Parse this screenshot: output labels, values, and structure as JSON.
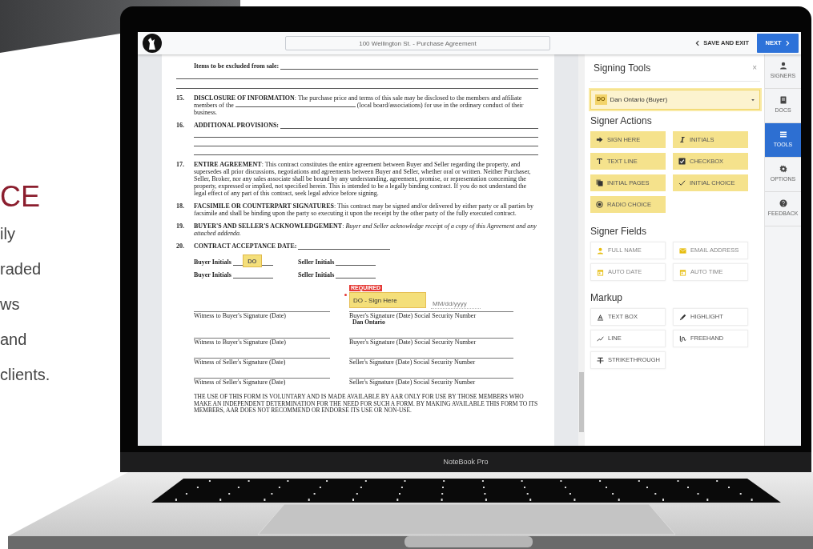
{
  "promo": {
    "heading": "CE",
    "lines": [
      "ily",
      "raded",
      "ws",
      "and",
      "clients."
    ]
  },
  "topbar": {
    "document_title": "100 Wellington St. - Purchase Agreement",
    "save_exit": "SAVE AND EXIT",
    "next": "NEXT"
  },
  "document": {
    "items": [
      {
        "kind": "fill",
        "text": "**Items to be excluded from sale:**"
      },
      {
        "kind": "clause",
        "number": "15.",
        "text": "**DISCLOSURE OF INFORMATION**: The purchase price and terms of this sale may be disclosed to the members and affiliate members of the",
        "text_after": "(local board/associations) for use in the ordinary conduct of their business."
      },
      {
        "kind": "provisions",
        "number": "16.",
        "text": "**ADDITIONAL PROVISIONS:**"
      },
      {
        "kind": "clause",
        "number": "17.",
        "text": "**ENTIRE AGREEMENT**: This contract constitutes the entire agreement between Buyer and Seller regarding the property, and supersedes all prior discussions, negotiations and agreements between Buyer and Seller, whether oral or written. Neither Purchaser, Seller, Broker, nor any sales associate shall be bound by any understanding, agreement, promise, or representation concerning the property, expressed or implied, not specified herein. This is intended to be a legally binding contract. If you do not understand the legal effect of any part of this contract, seek legal advice before signing."
      },
      {
        "kind": "clause",
        "number": "18.",
        "text": "**FACSIMILE OR COUNTERPART SIGNATURES**: This contract may be signed and/or delivered by either party or all parties by facsimile and shall be binding upon the party so executing it upon the receipt by the other party of the fully executed contract."
      },
      {
        "kind": "clause",
        "number": "19.",
        "text": "**BUYER'S AND SELLER'S ACKNOWLEDGEMENT**: *Buyer and Seller acknowledge receipt of a copy of this Agreement and any attached addenda.*"
      },
      {
        "kind": "date",
        "number": "20.",
        "text": "**CONTRACT ACCEPTANCE DATE:**"
      }
    ],
    "initials": [
      {
        "buyer": "Buyer Initials",
        "seller": "Seller Initials"
      },
      {
        "buyer": "Buyer Initials",
        "seller": "Seller Initials"
      }
    ],
    "signatures": [
      {
        "left": "Witness to Buyer's Signature (Date)",
        "right": "Buyer's Signature (Date) Social Security Number",
        "signer_name": "Dan Ontario"
      },
      {
        "left": "Witness to Buyer's Signature (Date)",
        "right": "Buyer's Signature (Date) Social Security Number"
      },
      {
        "left": "Witness of Seller's Signature (Date)",
        "right": "Seller's Signature (Date) Social Security Number"
      },
      {
        "left": "Witness of Seller's Signature (Date)",
        "right": "Seller's Signature (Date) Social Security Number"
      }
    ],
    "footer": "THE USE OF THIS FORM IS VOLUNTARY AND IS MADE AVAILABLE BY AAR ONLY FOR USE BY THOSE MEMBERS WHO MAKE AN INDEPENDENT DETERMINATION FOR THE NEED FOR SUCH A FORM. BY MAKING AVAILABLE THIS FORM TO ITS MEMBERS, AAR DOES NOT RECOMMEND OR ENDORSE ITS USE OR NON-USE.",
    "initials_tag": "DO",
    "sign_here": {
      "required": "REQUIRED",
      "label": "DO - Sign Here"
    },
    "date_placeholder": "MM/dd/yyyy"
  },
  "panel": {
    "title": "Signing Tools",
    "close": "×",
    "signer": {
      "initials": "DO",
      "name": "Dan Ontario (Buyer)"
    },
    "sections": [
      {
        "title": "Signer Actions",
        "kind": "action",
        "tools": [
          {
            "label": "SIGN HERE",
            "kind": "sign"
          },
          {
            "label": "INITIALS",
            "kind": "initials"
          },
          {
            "label": "TEXT LINE",
            "kind": "text"
          },
          {
            "label": "CHECKBOX",
            "kind": "checkbox"
          },
          {
            "label": "INITIAL PAGES",
            "kind": "pages"
          },
          {
            "label": "INITIAL CHOICE",
            "kind": "choice"
          },
          {
            "label": "RADIO CHOICE",
            "kind": "radio"
          }
        ]
      },
      {
        "title": "Signer Fields",
        "kind": "field",
        "tools": [
          {
            "label": "FULL NAME",
            "kind": "name"
          },
          {
            "label": "EMAIL ADDRESS",
            "kind": "email"
          },
          {
            "label": "AUTO DATE",
            "kind": "date"
          },
          {
            "label": "AUTO TIME",
            "kind": "date"
          }
        ]
      },
      {
        "title": "Markup",
        "kind": "markup",
        "tools": [
          {
            "label": "TEXT BOX",
            "kind": "textbox"
          },
          {
            "label": "HIGHLIGHT",
            "kind": "highlight"
          },
          {
            "label": "LINE",
            "kind": "line"
          },
          {
            "label": "FREEHAND",
            "kind": "freehand"
          },
          {
            "label": "STRIKETHROUGH",
            "kind": "strike"
          }
        ]
      }
    ]
  },
  "rail": [
    {
      "label": "SIGNERS",
      "kind": "signers",
      "selected": false
    },
    {
      "label": "DOCS",
      "kind": "docs",
      "selected": false
    },
    {
      "label": "TOOLS",
      "kind": "tools",
      "selected": true
    },
    {
      "label": "OPTIONS",
      "kind": "options",
      "selected": false
    },
    {
      "label": "FEEDBACK",
      "kind": "feedback",
      "selected": false
    }
  ],
  "laptop": {
    "label": "NoteBook Pro"
  }
}
